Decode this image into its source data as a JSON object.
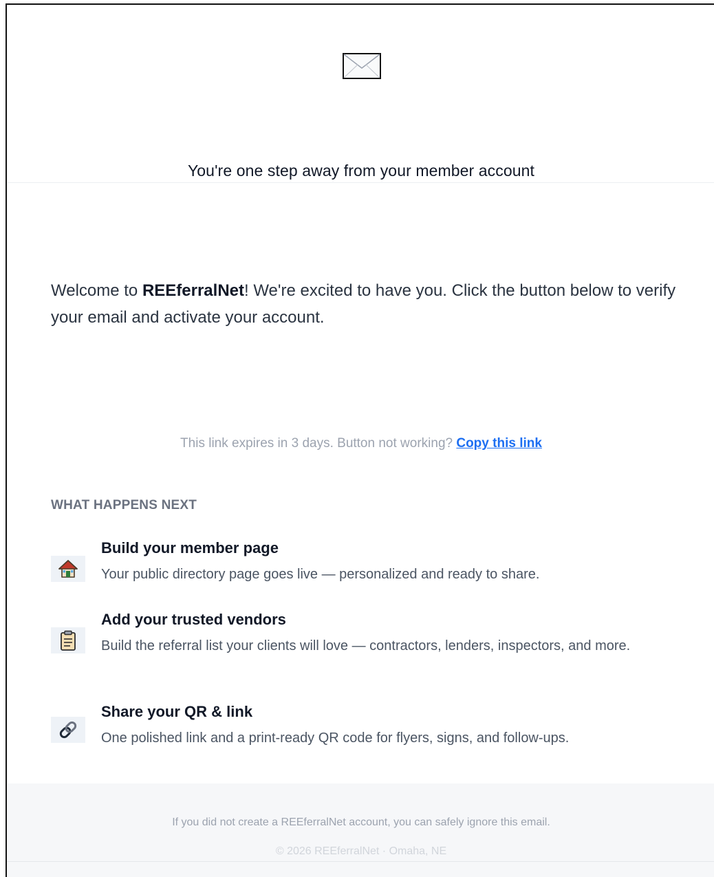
{
  "header": {
    "icon": "envelope-icon",
    "title": "You're one step away from your member account"
  },
  "welcome": {
    "prefix": "Welcome to ",
    "brand": "REEferralNet",
    "suffix": "! We're excited to have you. Click the button below to verify your email and activate your account."
  },
  "expiry": {
    "text": "This link expires in 3 days. Button not working? ",
    "link_label": "Copy this link",
    "link_color": "#1d6ff2"
  },
  "next": {
    "label": "WHAT HAPPENS NEXT",
    "steps": [
      {
        "icon": "house-icon",
        "title": "Build your member page",
        "description": "Your public directory page goes live — personalized and ready to share."
      },
      {
        "icon": "clipboard-icon",
        "title": "Add your trusted vendors",
        "description": "Build the referral list your clients will love — contractors, lenders, inspectors, and more."
      },
      {
        "icon": "link-icon",
        "title": "Share your QR & link",
        "description": "One polished link and a print-ready QR code for flyers, signs, and follow-ups."
      }
    ]
  },
  "footer": {
    "note": "If you did not create a REEferralNet account, you can safely ignore this email.",
    "copyright": "© 2026 REEferralNet · Omaha, NE"
  }
}
